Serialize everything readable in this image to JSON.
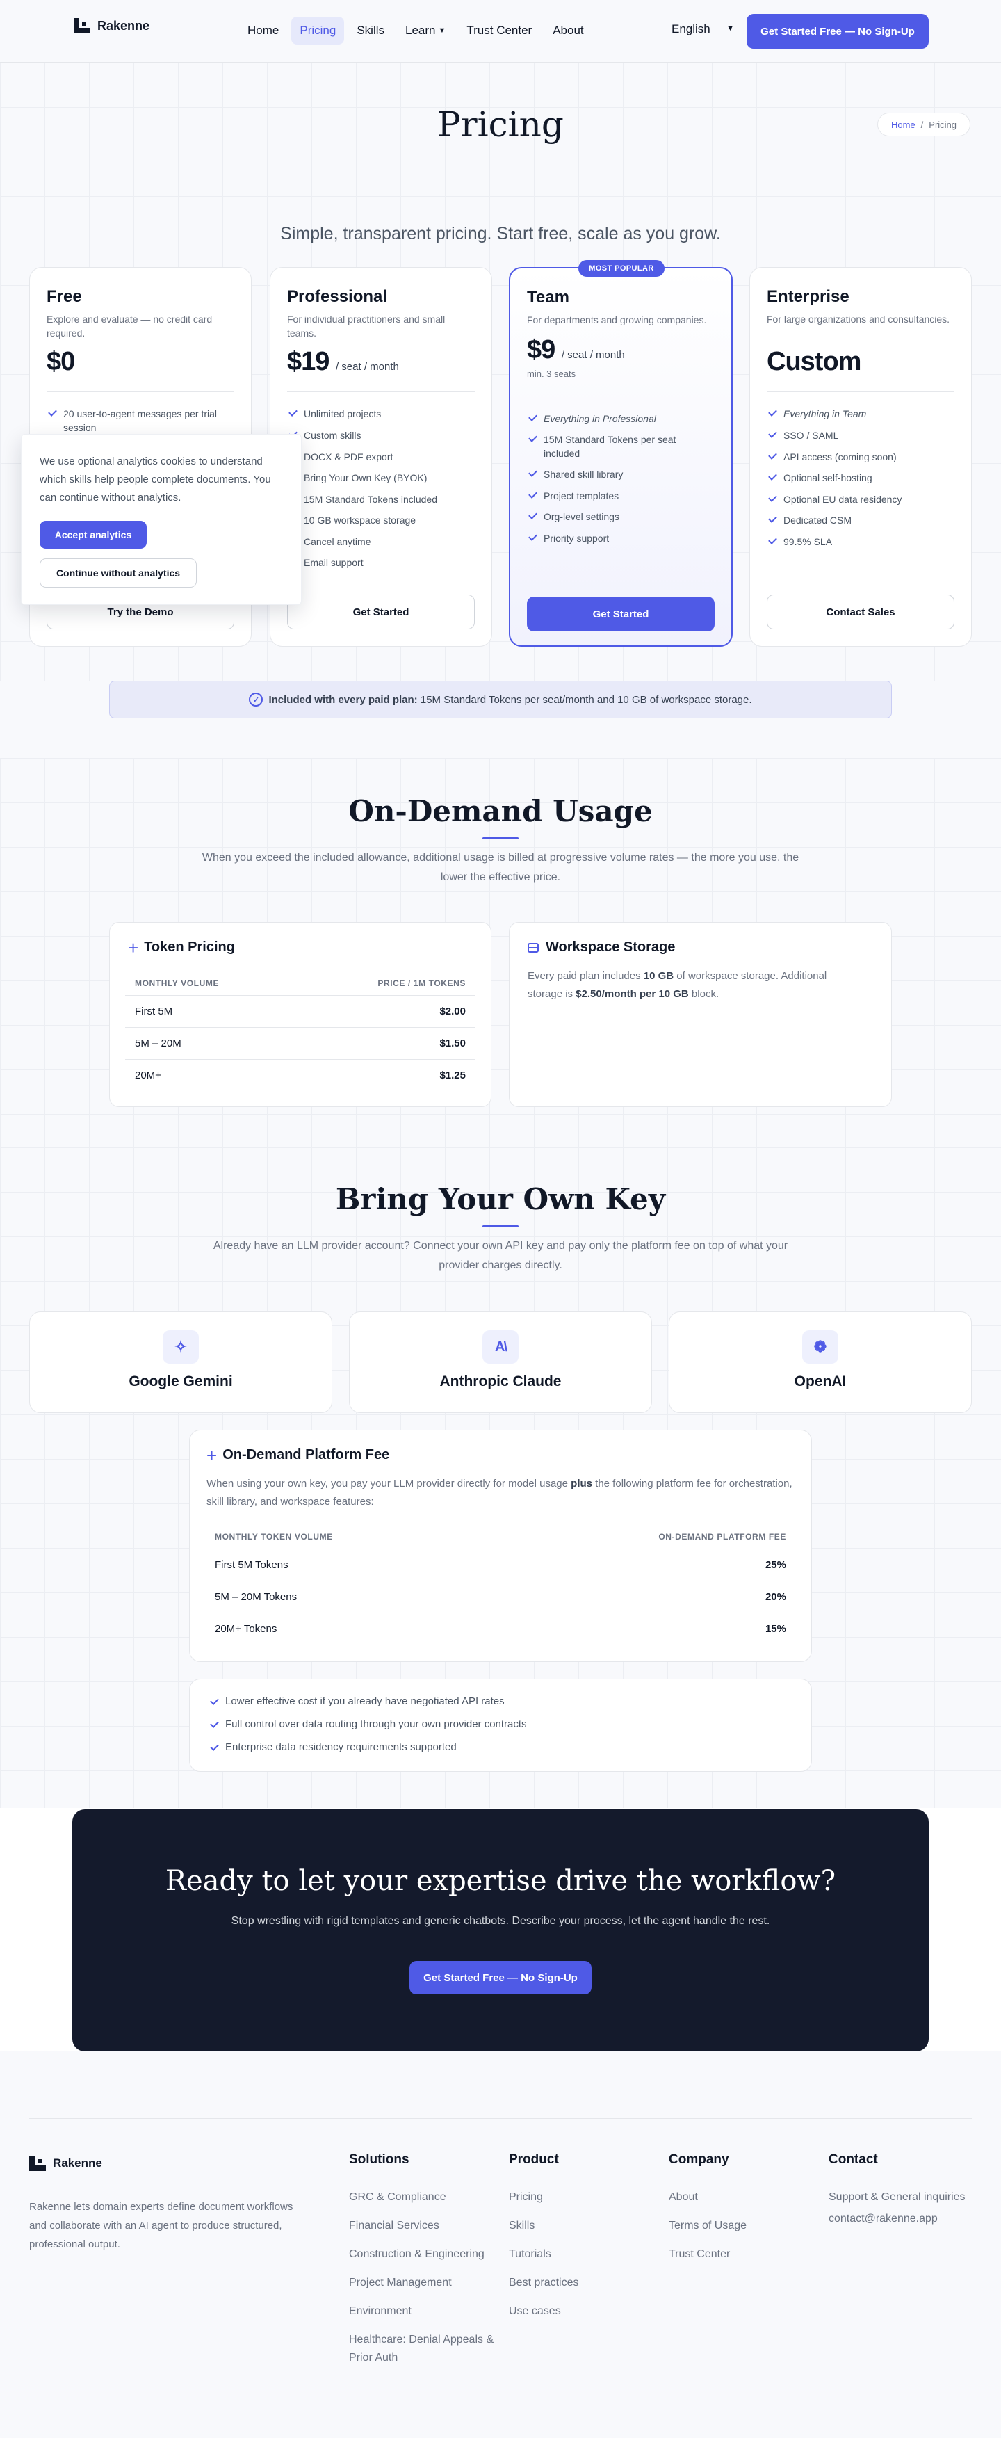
{
  "brand": {
    "name": "Rakenne"
  },
  "nav": {
    "items": [
      "Home",
      "Pricing",
      "Skills",
      "Learn",
      "Trust Center",
      "About"
    ],
    "language": "English",
    "cta": "Get Started Free — No Sign-Up"
  },
  "hero": {
    "title": "Pricing",
    "breadcrumb": {
      "home": "Home",
      "sep": "/",
      "current": "Pricing"
    },
    "tagline": "Simple, transparent pricing. Start free, scale as you grow."
  },
  "plans": [
    {
      "name": "Free",
      "desc": "Explore and evaluate — no credit card required.",
      "price": "$0",
      "unit": "",
      "note": "",
      "features": [
        "20 user-to-agent messages per trial session"
      ],
      "cta": "Try the Demo"
    },
    {
      "name": "Professional",
      "desc": "For individual practitioners and small teams.",
      "price": "$19",
      "unit": "/ seat / month",
      "note": "",
      "features": [
        "Unlimited projects",
        "Custom skills",
        "DOCX & PDF export",
        "Bring Your Own Key (BYOK)",
        "15M Standard Tokens included",
        "10 GB workspace storage",
        "Cancel anytime",
        "Email support"
      ],
      "cta": "Get Started"
    },
    {
      "name": "Team",
      "badge": "MOST POPULAR",
      "desc": "For departments and growing companies.",
      "price": "$9",
      "unit": "/ seat / month",
      "note": "min. 3 seats",
      "features": [
        "Everything in Professional",
        "15M Standard Tokens per seat included",
        "Shared skill library",
        "Project templates",
        "Org-level settings",
        "Priority support"
      ],
      "cta": "Get Started"
    },
    {
      "name": "Enterprise",
      "desc": "For large organizations and consultancies.",
      "price": "Custom",
      "unit": "",
      "note": "",
      "features": [
        "Everything in Team",
        "SSO / SAML",
        "API access (coming soon)",
        "Optional self-hosting",
        "Optional EU data residency",
        "Dedicated CSM",
        "99.5% SLA"
      ],
      "cta": "Contact Sales"
    }
  ],
  "cookie": {
    "text": "We use optional analytics cookies to understand which skills help people complete documents. You can continue without analytics.",
    "accept": "Accept analytics",
    "decline": "Continue without analytics"
  },
  "included": {
    "bold": "Included with every paid plan:",
    "text": " 15M Standard Tokens per seat/month and 10 GB of workspace storage."
  },
  "ondemand": {
    "title": "On-Demand Usage",
    "sub": "When you exceed the included allowance, additional usage is billed at progressive volume rates — the more you use, the lower the effective price.",
    "token": {
      "title": "Token Pricing",
      "col1": "MONTHLY VOLUME",
      "col2": "PRICE / 1M TOKENS",
      "rows": [
        {
          "v": "First 5M",
          "p": "$2.00"
        },
        {
          "v": "5M – 20M",
          "p": "$1.50"
        },
        {
          "v": "20M+",
          "p": "$1.25"
        }
      ]
    },
    "storage": {
      "title": "Workspace Storage",
      "t1": "Every paid plan includes ",
      "b1": "10 GB",
      "t2": " of workspace storage. Additional storage is ",
      "b2": "$2.50/month per 10 GB",
      "t3": " block."
    }
  },
  "byok": {
    "title": "Bring Your Own Key",
    "sub": "Already have an LLM provider account? Connect your own API key and pay only the platform fee on top of what your provider charges directly.",
    "providers": [
      "Google Gemini",
      "Anthropic Claude",
      "OpenAI"
    ],
    "fee": {
      "title": "On-Demand Platform Fee",
      "t1": "When using your own key, you pay your LLM provider directly for model usage ",
      "b1": "plus",
      "t2": " the following platform fee for orchestration, skill library, and workspace features:",
      "col1": "MONTHLY TOKEN VOLUME",
      "col2": "ON-DEMAND PLATFORM FEE",
      "rows": [
        {
          "v": "First 5M Tokens",
          "p": "25%"
        },
        {
          "v": "5M – 20M Tokens",
          "p": "20%"
        },
        {
          "v": "20M+ Tokens",
          "p": "15%"
        }
      ]
    },
    "benefits": [
      "Lower effective cost if you already have negotiated API rates",
      "Full control over data routing through your own provider contracts",
      "Enterprise data residency requirements supported"
    ]
  },
  "cta": {
    "title": "Ready to let your expertise drive the workflow?",
    "sub": "Stop wrestling with rigid templates and generic chatbots. Describe your process, let the agent handle the rest.",
    "button": "Get Started Free — No Sign-Up"
  },
  "footer": {
    "about": "Rakenne lets domain experts define document workflows and collaborate with an AI agent to produce structured, professional output.",
    "cols": [
      {
        "h": "Solutions",
        "links": [
          "GRC & Compliance",
          "Financial Services",
          "Construction & Engineering",
          "Project Management",
          "Environment",
          "Healthcare: Denial Appeals & Prior Auth"
        ]
      },
      {
        "h": "Product",
        "links": [
          "Pricing",
          "Skills",
          "Tutorials",
          "Best practices",
          "Use cases"
        ]
      },
      {
        "h": "Company",
        "links": [
          "About",
          "Terms of Usage",
          "Trust Center"
        ]
      },
      {
        "h": "Contact",
        "links": [
          "Support & General inquiries",
          "contact@rakenne.app"
        ]
      }
    ]
  }
}
